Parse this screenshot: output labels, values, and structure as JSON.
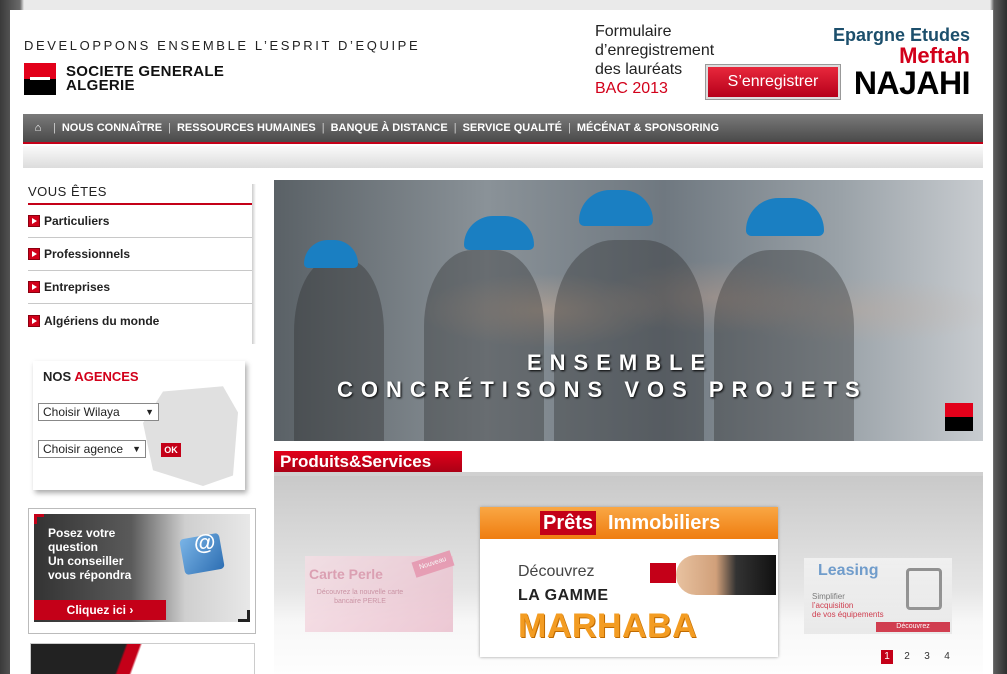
{
  "header": {
    "tagline": "DEVELOPPONS ENSEMBLE L’ESPRIT D’EQUIPE",
    "logo_line1": "SOCIETE GENERALE",
    "logo_line2": "ALGERIE",
    "bac_line1": "Formulaire",
    "bac_line2": "d’enregistrement",
    "bac_line3": "des lauréats",
    "bac_year": "BAC 2013",
    "register_button": "S’enregistrer",
    "epargne_line1": "Epargne Etudes",
    "epargne_line2": "Meftah",
    "epargne_line3": "NAJAHI"
  },
  "nav": {
    "home_icon": "home-icon",
    "items": [
      "NOUS CONNAÎTRE",
      "RESSOURCES HUMAINES",
      "BANQUE À DISTANCE",
      "SERVICE QUALITÉ",
      "MÉCÉNAT & SPONSORING"
    ]
  },
  "vous_etes": {
    "title": "VOUS ÊTES",
    "items": [
      "Particuliers",
      "Professionnels",
      "Entreprises",
      "Algériens du monde"
    ]
  },
  "agences": {
    "title_prefix": "NOS",
    "title_highlight": "AGENCES",
    "wilaya_select": "Choisir Wilaya",
    "agence_select": "Choisir agence",
    "ok_button": "OK"
  },
  "conseil": {
    "line1": "Posez votre",
    "line2": "question",
    "line3": "Un conseiller",
    "line4": "vous répondra",
    "button": "Cliquez ici"
  },
  "hero": {
    "line1": "ENSEMBLE",
    "line2": "CONCRÉTISONS VOS PROJETS"
  },
  "products": {
    "title": "Produits&Services",
    "perle_title": "Carte Perle",
    "perle_sub": "Découvrez la nouvelle carte bancaire PERLE",
    "perle_ribbon": "Nouveau",
    "main_word1": "Prêts",
    "main_word2": "Immobiliers",
    "main_discover": "Découvrez",
    "main_range": "LA GAMME",
    "main_brand": "MARHABA",
    "leasing_title": "Leasing",
    "leasing_sub1": "Simplifier",
    "leasing_sub2": "l’acquisition",
    "leasing_sub3": "de vos équipements",
    "leasing_button": "Découvrez"
  },
  "pager": [
    "1",
    "2",
    "3",
    "4"
  ],
  "colors": {
    "brand_red": "#e2001a",
    "nav_grey": "#5a5a5a",
    "orange": "#ef7d10"
  }
}
